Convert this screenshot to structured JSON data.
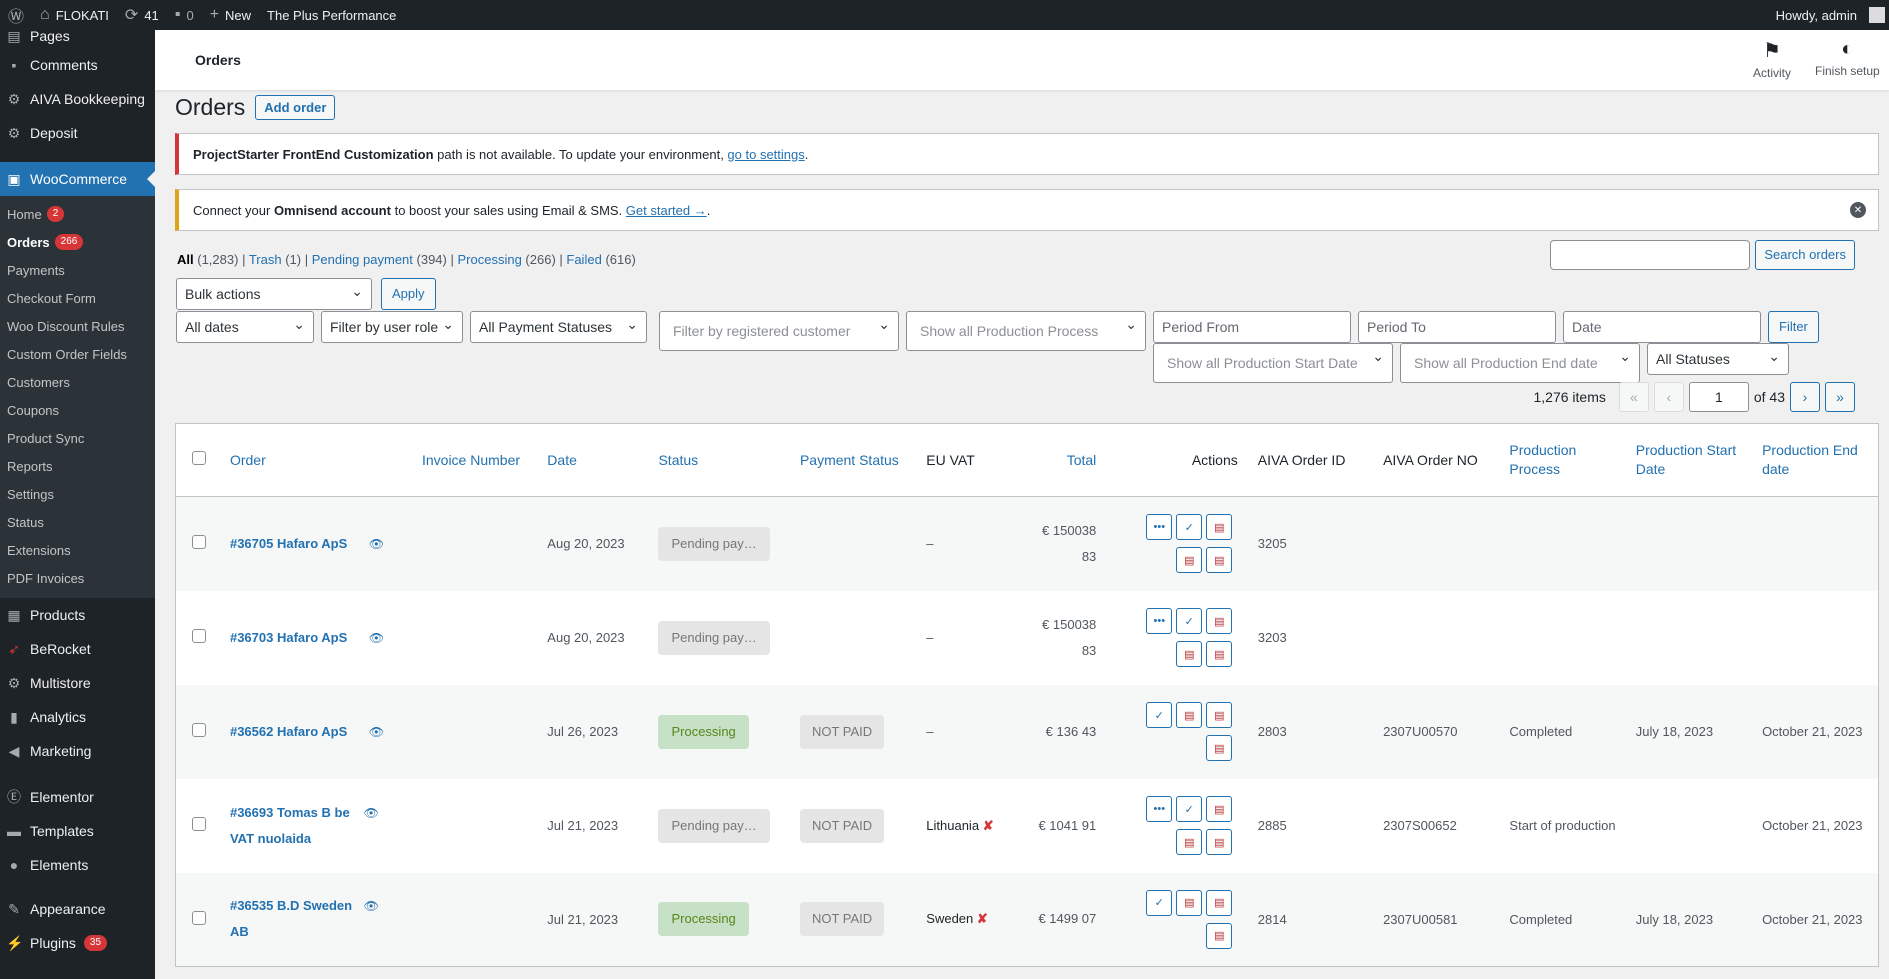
{
  "adminbar": {
    "site": "FLOKATI",
    "updates": "41",
    "comments": "0",
    "new": "New",
    "plus": "The Plus Performance",
    "howdy": "Howdy, admin"
  },
  "menu": {
    "pages": "Pages",
    "comments": "Comments",
    "aiva": "AIVA Bookkeeping",
    "deposit": "Deposit",
    "woocommerce": "WooCommerce",
    "sub": {
      "home": "Home",
      "home_badge": "2",
      "orders": "Orders",
      "orders_badge": "266",
      "payments": "Payments",
      "checkout": "Checkout Form",
      "discount": "Woo Discount Rules",
      "custom": "Custom Order Fields",
      "customers": "Customers",
      "coupons": "Coupons",
      "sync": "Product Sync",
      "reports": "Reports",
      "settings": "Settings",
      "status": "Status",
      "extensions": "Extensions",
      "pdf": "PDF Invoices"
    },
    "products": "Products",
    "berocket": "BeRocket",
    "multistore": "Multistore",
    "analytics": "Analytics",
    "marketing": "Marketing",
    "elementor": "Elementor",
    "templates": "Templates",
    "elements": "Elements",
    "appearance": "Appearance",
    "plugins": "Plugins",
    "plugins_badge": "35"
  },
  "header": {
    "title": "Orders",
    "activity": "Activity",
    "finish": "Finish setup"
  },
  "page": {
    "h1": "Orders",
    "add": "Add order"
  },
  "notice1": {
    "strong": "ProjectStarter FrontEnd Customization",
    "text": " path is not available. To update your environment, ",
    "link": "go to settings",
    "end": "."
  },
  "notice2": {
    "pre": "Connect your ",
    "strong": "Omnisend account",
    "text": " to boost your sales using Email & SMS. ",
    "link": "Get started →",
    "end": "."
  },
  "views": {
    "all": "All",
    "all_c": "(1,283)",
    "trash": "Trash",
    "trash_c": "(1)",
    "pending": "Pending payment",
    "pending_c": "(394)",
    "processing": "Processing",
    "processing_c": "(266)",
    "failed": "Failed",
    "failed_c": "(616)"
  },
  "search_btn": "Search orders",
  "filters": {
    "bulk": "Bulk actions",
    "apply": "Apply",
    "dates": "All dates",
    "role": "Filter by user role",
    "pay": "All Payment Statuses",
    "cust": "Filter by registered customer",
    "prod": "Show all Production Process",
    "from": "Period From",
    "to": "Period To",
    "date": "Date",
    "filter": "Filter",
    "pstart": "Show all Production Start Date",
    "pend": "Show all Production End date",
    "statuses": "All Statuses"
  },
  "pagination": {
    "items": "1,276 items",
    "first": "«",
    "prev": "‹",
    "page": "1",
    "of": "of 43",
    "next": "›",
    "last": "»"
  },
  "columns": {
    "order": "Order",
    "invoice": "Invoice Number",
    "date": "Date",
    "status": "Status",
    "payment": "Payment Status",
    "vat": "EU VAT",
    "total": "Total",
    "actions": "Actions",
    "aiva_id": "AIVA Order ID",
    "aiva_no": "AIVA Order NO",
    "process": "Production Process",
    "pstart": "Production Start Date",
    "pend": "Production End date"
  },
  "rows": [
    {
      "order": "#36705 Hafaro ApS",
      "date": "Aug 20, 2023",
      "status": "Pending pay…",
      "payment": "",
      "vat": "–",
      "total1": "€ 150038",
      "total2": "83",
      "aiva_id": "3205",
      "aiva_no": "",
      "process": "",
      "pstart": "",
      "pend": ""
    },
    {
      "order": "#36703 Hafaro ApS",
      "date": "Aug 20, 2023",
      "status": "Pending pay…",
      "payment": "",
      "vat": "–",
      "total1": "€ 150038",
      "total2": "83",
      "aiva_id": "3203",
      "aiva_no": "",
      "process": "",
      "pstart": "",
      "pend": ""
    },
    {
      "order": "#36562 Hafaro ApS",
      "date": "Jul 26, 2023",
      "status": "Processing",
      "payment": "NOT PAID",
      "vat": "–",
      "total1": "€ 136 43",
      "total2": "",
      "aiva_id": "2803",
      "aiva_no": "2307U00570",
      "process": "Completed",
      "pstart": "July 18, 2023",
      "pend": "October 21, 2023"
    },
    {
      "order": "#36693 Tomas B be VAT nuolaida",
      "date": "Jul 21, 2023",
      "status": "Pending pay…",
      "payment": "NOT PAID",
      "vat": "Lithuania",
      "total1": "€ 1041 91",
      "total2": "",
      "aiva_id": "2885",
      "aiva_no": "2307S00652",
      "process": "Start of production",
      "pstart": "",
      "pend": "October 21, 2023"
    },
    {
      "order": "#36535 B.D Sweden AB",
      "date": "Jul 21, 2023",
      "status": "Processing",
      "payment": "NOT PAID",
      "vat": "Sweden",
      "total1": "€ 1499 07",
      "total2": "",
      "aiva_id": "2814",
      "aiva_no": "2307U00581",
      "process": "Completed",
      "pstart": "July 18, 2023",
      "pend": "October 21, 2023"
    }
  ]
}
